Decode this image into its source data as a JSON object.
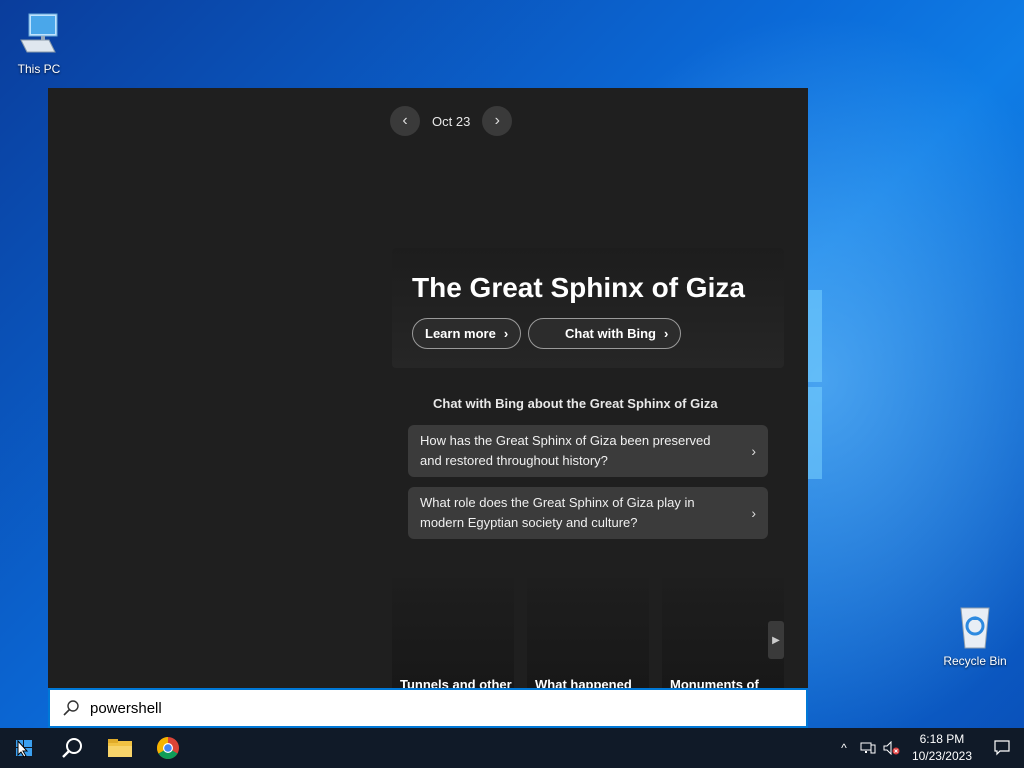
{
  "desktop": {
    "icons": [
      {
        "label": "This PC"
      },
      {
        "label": "Recycle Bin"
      }
    ]
  },
  "flyout": {
    "date_nav": {
      "label": "Oct 23",
      "prev_glyph": "‹",
      "next_glyph": "›"
    },
    "hero": {
      "title": "The Great Sphinx of Giza",
      "learn_more_label": "Learn more",
      "chat_label": "Chat with Bing"
    },
    "chat_heading": "Chat with Bing about the Great Sphinx of Giza",
    "questions": [
      {
        "text": "How has the Great Sphinx of Giza been preserved and restored throughout history?"
      },
      {
        "text": "What role does the Great Sphinx of Giza play in modern Egyptian society and culture?"
      }
    ],
    "tiles": [
      {
        "label": "Tunnels and other"
      },
      {
        "label": "What happened"
      },
      {
        "label": "Monuments of"
      }
    ]
  },
  "search": {
    "value": "powershell"
  },
  "taskbar": {
    "clock_time": "6:18 PM",
    "clock_date": "10/23/2023"
  },
  "colors": {
    "flyout_bg": "#1f1f1f",
    "taskbar_bg": "#101a28",
    "accent": "#0078d7"
  }
}
